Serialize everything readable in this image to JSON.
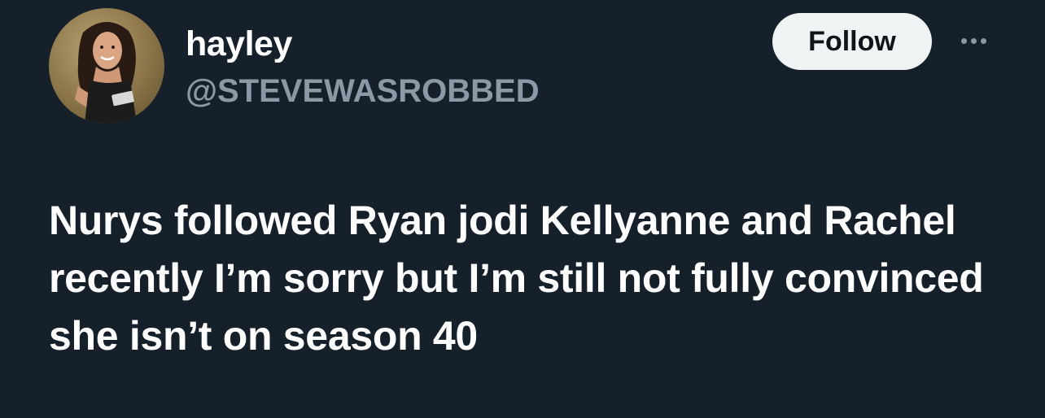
{
  "author": {
    "display_name": "hayley",
    "handle": "@STEVEWASROBBED",
    "avatar_icon": "profile-photo"
  },
  "actions": {
    "follow_label": "Follow",
    "more_icon": "more-horizontal-icon"
  },
  "tweet": {
    "text": "Nurys followed Ryan jodi Kellyanne and Rachel recently I’m sorry but I’m still not fully convinced she isn’t on season 40"
  },
  "colors": {
    "background": "#15202b",
    "text_primary": "#ffffff",
    "text_secondary": "#8b98a5",
    "button_bg": "#eff3f4",
    "button_text": "#0f1419"
  }
}
